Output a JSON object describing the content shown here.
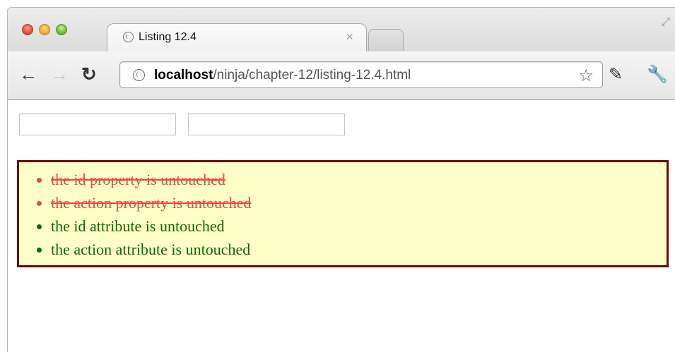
{
  "browser": {
    "tab_title": "Listing 12.4",
    "tab_close": "×",
    "url_host": "localhost",
    "url_path": "/ninja/chapter-12/listing-12.4.html"
  },
  "form": {
    "input1_value": "",
    "input2_value": ""
  },
  "results": [
    {
      "text": "the id property is untouched",
      "status": "fail"
    },
    {
      "text": "the action property is untouched",
      "status": "fail"
    },
    {
      "text": "the id attribute is untouched",
      "status": "pass"
    },
    {
      "text": "the action attribute is untouched",
      "status": "pass"
    }
  ],
  "colors": {
    "fail": "#e34a4a",
    "pass": "#0b6a0b",
    "results_bg": "#ffffc8",
    "results_border": "#6b0707"
  }
}
